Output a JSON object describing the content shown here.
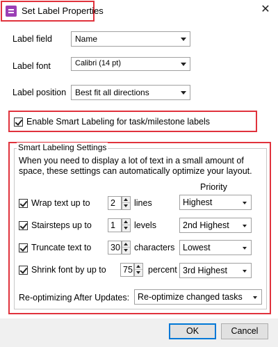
{
  "window": {
    "title": "Set Label Properties",
    "close_glyph": "✕",
    "icon": "label-app-icon"
  },
  "fields": {
    "label_field": {
      "label": "Label field",
      "value": "Name"
    },
    "label_font": {
      "label": "Label font",
      "value": "Calibri (14 pt)"
    },
    "label_position": {
      "label": "Label position",
      "value": "Best fit all directions"
    }
  },
  "smart_labeling": {
    "enable_label": "Enable Smart Labeling for task/milestone labels",
    "enabled": true
  },
  "settings_group": {
    "title": "Smart Labeling Settings",
    "description": "When you need to display a lot of text in a small amount of space, these settings can automatically optimize your layout.",
    "priority_header": "Priority",
    "rows": [
      {
        "label": "Wrap text up to",
        "value": "2",
        "unit": "lines",
        "priority": "Highest",
        "checked": true
      },
      {
        "label": "Stairsteps up to",
        "value": "1",
        "unit": "levels",
        "priority": "2nd Highest",
        "checked": true
      },
      {
        "label": "Truncate text to",
        "value": "30",
        "unit": "characters",
        "priority": "Lowest",
        "checked": true
      },
      {
        "label": "Shrink font by up to",
        "value": "75",
        "unit": "percent",
        "priority": "3rd Highest",
        "checked": true
      }
    ],
    "reoptimize_label": "Re-optimizing After Updates:",
    "reoptimize_value": "Re-optimize changed tasks"
  },
  "buttons": {
    "ok": "OK",
    "cancel": "Cancel"
  },
  "colors": {
    "highlight": "#e0323c",
    "app_icon": "#9b3fb5",
    "default_button_border": "#0078d7"
  }
}
